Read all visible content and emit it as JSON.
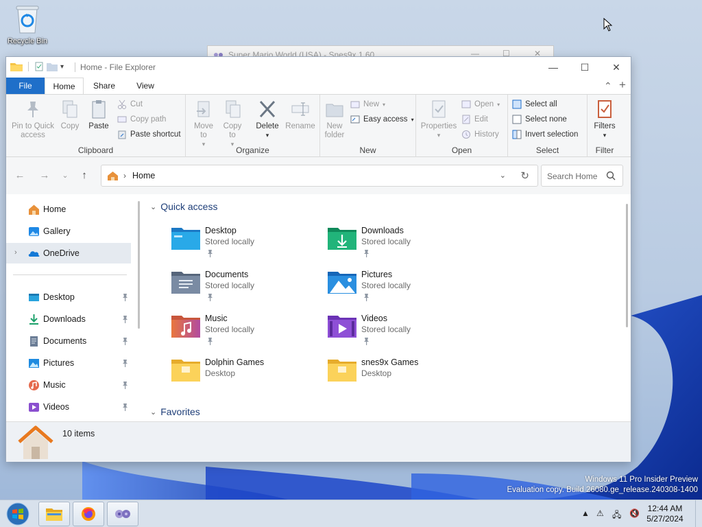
{
  "desktop": {
    "recycle_bin_label": "Recycle Bin",
    "background_window_title": "Super Mario World (USA) - Snes9x 1.60",
    "watermark_line1": "Windows 11 Pro Insider Preview",
    "watermark_line2": "Evaluation copy. Build 26080.ge_release.240308-1400"
  },
  "window": {
    "title": "Home - File Explorer",
    "controls": {
      "minimize": "—",
      "maximize": "☐",
      "close": "✕"
    }
  },
  "ribbon_tabs": {
    "file": "File",
    "home": "Home",
    "share": "Share",
    "view": "View"
  },
  "ribbon": {
    "clipboard": {
      "label": "Clipboard",
      "pin": "Pin to Quick access",
      "copy": "Copy",
      "paste": "Paste",
      "cut": "Cut",
      "copy_path": "Copy path",
      "paste_shortcut": "Paste shortcut"
    },
    "organize": {
      "label": "Organize",
      "move_to": "Move to",
      "copy_to": "Copy to",
      "delete": "Delete",
      "rename": "Rename"
    },
    "new": {
      "label": "New",
      "new_folder": "New folder",
      "new_item": "New",
      "easy_access": "Easy access"
    },
    "open": {
      "label": "Open",
      "properties": "Properties",
      "open": "Open",
      "edit": "Edit",
      "history": "History"
    },
    "select": {
      "label": "Select",
      "select_all": "Select all",
      "select_none": "Select none",
      "invert": "Invert selection"
    },
    "filter": {
      "label": "Filter",
      "filters": "Filters"
    }
  },
  "address": {
    "path": "Home",
    "search_placeholder": "Search Home"
  },
  "nav_pane": {
    "top": [
      {
        "label": "Home",
        "icon": "home-icon"
      },
      {
        "label": "Gallery",
        "icon": "gallery-icon"
      },
      {
        "label": "OneDrive",
        "icon": "onedrive-icon",
        "selected": true
      }
    ],
    "pinned": [
      {
        "label": "Desktop",
        "icon": "desktop-folder-icon"
      },
      {
        "label": "Downloads",
        "icon": "downloads-folder-icon"
      },
      {
        "label": "Documents",
        "icon": "documents-folder-icon"
      },
      {
        "label": "Pictures",
        "icon": "pictures-folder-icon"
      },
      {
        "label": "Music",
        "icon": "music-folder-icon"
      },
      {
        "label": "Videos",
        "icon": "videos-folder-icon"
      }
    ]
  },
  "content": {
    "quick_access_label": "Quick access",
    "favorites_label": "Favorites",
    "tiles": [
      {
        "name": "Desktop",
        "sub": "Stored locally",
        "icon": "desktop-folder-icon",
        "pinned": true
      },
      {
        "name": "Downloads",
        "sub": "Stored locally",
        "icon": "downloads-folder-icon",
        "pinned": true
      },
      {
        "name": "Documents",
        "sub": "Stored locally",
        "icon": "documents-folder-icon",
        "pinned": true
      },
      {
        "name": "Pictures",
        "sub": "Stored locally",
        "icon": "pictures-folder-icon",
        "pinned": true
      },
      {
        "name": "Music",
        "sub": "Stored locally",
        "icon": "music-folder-icon",
        "pinned": true
      },
      {
        "name": "Videos",
        "sub": "Stored locally",
        "icon": "videos-folder-icon",
        "pinned": true
      },
      {
        "name": "Dolphin Games",
        "sub": "Desktop",
        "icon": "folder-icon",
        "pinned": false
      },
      {
        "name": "snes9x Games",
        "sub": "Desktop",
        "icon": "folder-icon",
        "pinned": false
      }
    ]
  },
  "status": {
    "item_count": "10 items"
  },
  "taskbar": {
    "clock_time": "12:44 AM",
    "clock_date": "5/27/2024",
    "apps": [
      "file-explorer-icon",
      "firefox-icon",
      "snes9x-icon"
    ]
  },
  "colors": {
    "accent": "#1f6fc9",
    "section_heading": "#1e3e78",
    "folder_yellow": "#f6c445"
  }
}
